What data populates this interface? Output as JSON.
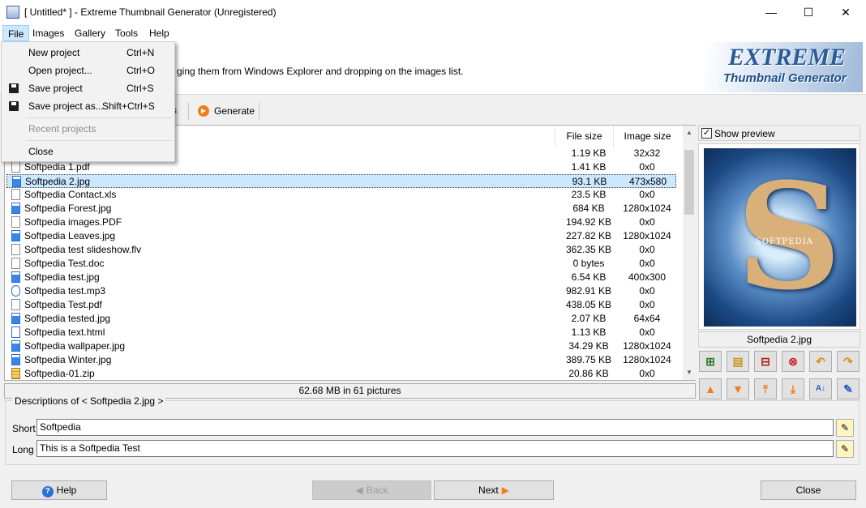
{
  "window": {
    "title": "[ Untitled* ] - Extreme Thumbnail Generator (Unregistered)",
    "minimize_glyph": "—",
    "maximize_glyph": "☐",
    "close_glyph": "✕"
  },
  "menubar": {
    "items": [
      "File",
      "Images",
      "Gallery",
      "Tools",
      "Help"
    ]
  },
  "file_menu": {
    "items": [
      {
        "label": "New project",
        "shortcut": "Ctrl+N",
        "enabled": true
      },
      {
        "label": "Open project...",
        "shortcut": "Ctrl+O",
        "enabled": true
      },
      {
        "label": "Save project",
        "shortcut": "Ctrl+S",
        "enabled": true
      },
      {
        "label": "Save project as...",
        "shortcut": "Shift+Ctrl+S",
        "enabled": true
      },
      {
        "label": "Recent projects",
        "shortcut": "",
        "enabled": false
      },
      {
        "label": "Close",
        "shortcut": "",
        "enabled": true
      }
    ]
  },
  "banner": {
    "message_visible": "ging them from Windows Explorer and dropping on the images list.",
    "logo_line1": "EXTREME",
    "logo_line2": "Thumbnail Generator"
  },
  "toolbar": {
    "partial_label": "s",
    "generate_label": "Generate"
  },
  "filelist": {
    "columns": {
      "size": "File size",
      "image_size": "Image size"
    },
    "rows": [
      {
        "name": "",
        "type": "jpg",
        "size": "1.19 KB",
        "image_size": "32x32",
        "selected": false
      },
      {
        "name": "Softpedia 1.pdf",
        "type": "pdf",
        "size": "1.41 KB",
        "image_size": "0x0",
        "selected": false
      },
      {
        "name": "Softpedia 2.jpg",
        "type": "jpg",
        "size": "93.1 KB",
        "image_size": "473x580",
        "selected": true
      },
      {
        "name": "Softpedia Contact.xls",
        "type": "doc",
        "size": "23.5 KB",
        "image_size": "0x0",
        "selected": false
      },
      {
        "name": "Softpedia Forest.jpg",
        "type": "jpg",
        "size": "684 KB",
        "image_size": "1280x1024",
        "selected": false
      },
      {
        "name": "Softpedia images.PDF",
        "type": "pdf",
        "size": "194.92 KB",
        "image_size": "0x0",
        "selected": false
      },
      {
        "name": "Softpedia Leaves.jpg",
        "type": "jpg",
        "size": "227.82 KB",
        "image_size": "1280x1024",
        "selected": false
      },
      {
        "name": "Softpedia test slideshow.flv",
        "type": "doc",
        "size": "362.35 KB",
        "image_size": "0x0",
        "selected": false
      },
      {
        "name": "Softpedia Test.doc",
        "type": "doc",
        "size": "0 bytes",
        "image_size": "0x0",
        "selected": false
      },
      {
        "name": "Softpedia test.jpg",
        "type": "jpg",
        "size": "6.54 KB",
        "image_size": "400x300",
        "selected": false
      },
      {
        "name": "Softpedia test.mp3",
        "type": "mp3",
        "size": "982.91 KB",
        "image_size": "0x0",
        "selected": false
      },
      {
        "name": "Softpedia Test.pdf",
        "type": "pdf",
        "size": "438.05 KB",
        "image_size": "0x0",
        "selected": false
      },
      {
        "name": "Softpedia tested.jpg",
        "type": "jpg",
        "size": "2.07 KB",
        "image_size": "64x64",
        "selected": false
      },
      {
        "name": "Softpedia text.html",
        "type": "html",
        "size": "1.13 KB",
        "image_size": "0x0",
        "selected": false
      },
      {
        "name": "Softpedia wallpaper.jpg",
        "type": "jpg",
        "size": "34.29 KB",
        "image_size": "1280x1024",
        "selected": false
      },
      {
        "name": "Softpedia Winter.jpg",
        "type": "jpg",
        "size": "389.75 KB",
        "image_size": "1280x1024",
        "selected": false
      },
      {
        "name": "Softpedia-01.zip",
        "type": "zip",
        "size": "20.86 KB",
        "image_size": "0x0",
        "selected": false
      }
    ],
    "status": "62.68 MB in 61 pictures"
  },
  "preview": {
    "checkbox_label": "Show preview",
    "checked": true,
    "filename": "Softpedia 2.jpg",
    "image_caption": "SOFTPEDIA"
  },
  "description": {
    "legend": "Descriptions of < Softpedia 2.jpg >",
    "short_label": "Short",
    "short_value": "Softpedia",
    "long_label": "Long",
    "long_value": "This is a Softpedia Test"
  },
  "bottom": {
    "help": "Help",
    "back": "Back",
    "next": "Next",
    "close": "Close"
  }
}
